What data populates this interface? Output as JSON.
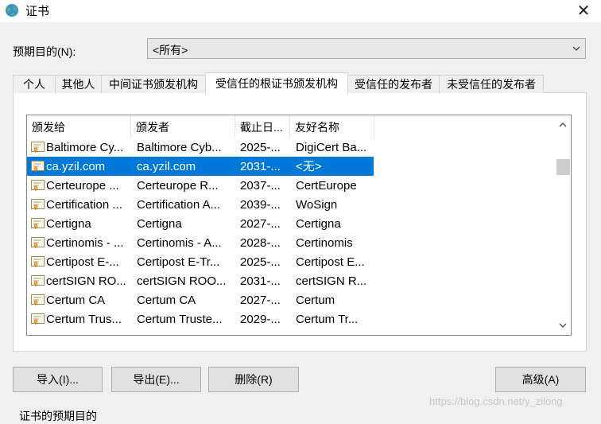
{
  "window": {
    "title": "证书",
    "close_glyph": "✕"
  },
  "purpose": {
    "label": "预期目的(N):",
    "value": "<所有>"
  },
  "tabs": [
    {
      "label": "个人"
    },
    {
      "label": "其他人"
    },
    {
      "label": "中间证书颁发机构"
    },
    {
      "label": "受信任的根证书颁发机构",
      "active": true
    },
    {
      "label": "受信任的发布者"
    },
    {
      "label": "未受信任的发布者"
    }
  ],
  "columns": [
    "颁发给",
    "颁发者",
    "截止日...",
    "友好名称"
  ],
  "rows": [
    {
      "issued_to": "Baltimore Cy...",
      "issuer": "Baltimore Cyb...",
      "expiry": "2025-...",
      "friendly": "DigiCert Ba..."
    },
    {
      "issued_to": "ca.yzil.com",
      "issuer": "ca.yzil.com",
      "expiry": "2031-...",
      "friendly": "<无>",
      "selected": true
    },
    {
      "issued_to": "Certeurope ...",
      "issuer": "Certeurope R...",
      "expiry": "2037-...",
      "friendly": "CertEurope"
    },
    {
      "issued_to": "Certification ...",
      "issuer": "Certification A...",
      "expiry": "2039-...",
      "friendly": "WoSign"
    },
    {
      "issued_to": "Certigna",
      "issuer": "Certigna",
      "expiry": "2027-...",
      "friendly": "Certigna"
    },
    {
      "issued_to": "Certinomis - ...",
      "issuer": "Certinomis - A...",
      "expiry": "2028-...",
      "friendly": "Certinomis"
    },
    {
      "issued_to": "Certipost E-...",
      "issuer": "Certipost E-Tr...",
      "expiry": "2025-...",
      "friendly": "Certipost E..."
    },
    {
      "issued_to": "certSIGN RO...",
      "issuer": "certSIGN ROO...",
      "expiry": "2031-...",
      "friendly": "certSIGN R..."
    },
    {
      "issued_to": "Certum CA",
      "issuer": "Certum CA",
      "expiry": "2027-...",
      "friendly": "Certum"
    },
    {
      "issued_to": "Certum Trus...",
      "issuer": "Certum Truste...",
      "expiry": "2029-...",
      "friendly": "Certum Tr..."
    }
  ],
  "buttons": {
    "import": "导入(I)...",
    "export": "导出(E)...",
    "remove": "删除(R)",
    "advanced": "高级(A)"
  },
  "watermark": "https://blog.csdn.net/y_zilong",
  "bottom_label": "证书的预期目的"
}
